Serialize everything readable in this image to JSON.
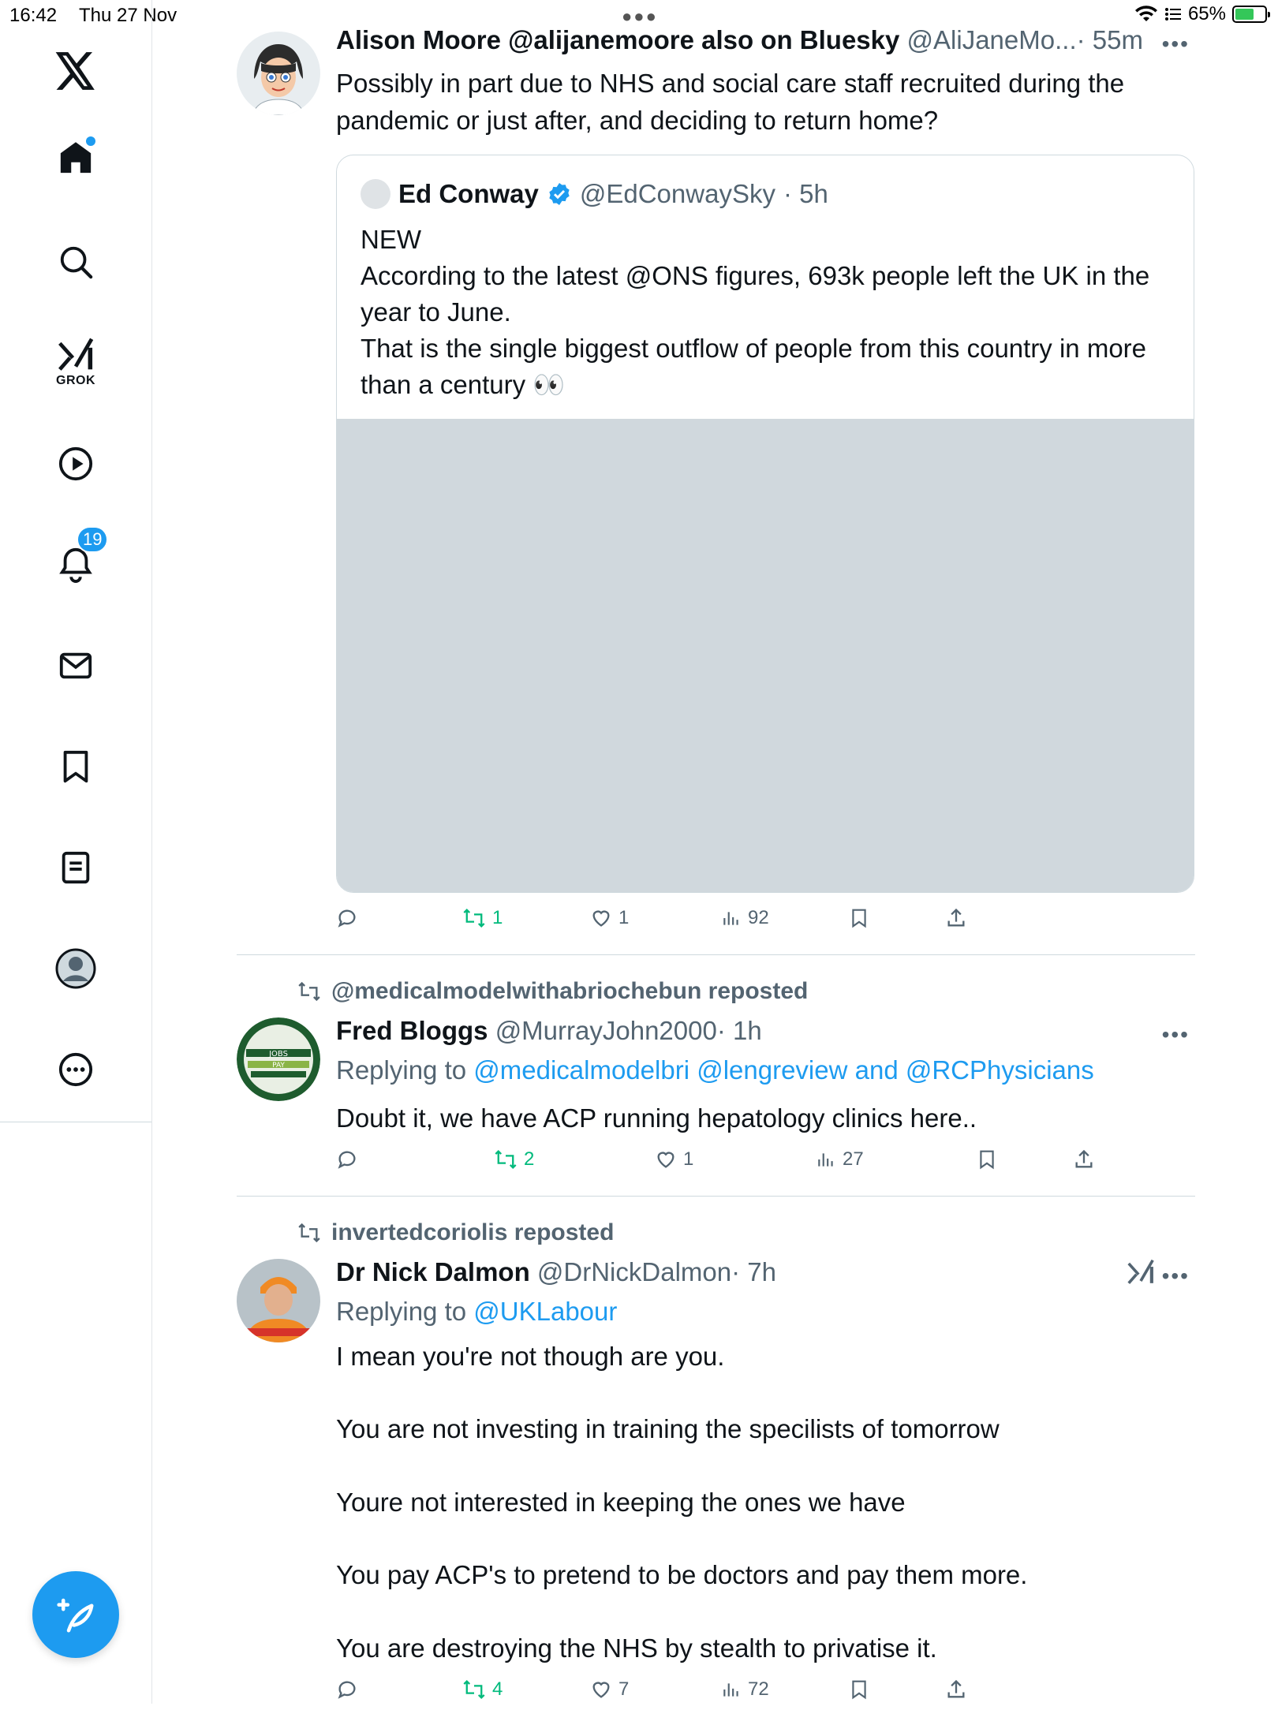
{
  "status_bar": {
    "time": "16:42",
    "date": "Thu 27 Nov",
    "battery": "65%",
    "battery_level": 0.65
  },
  "sidebar": {
    "grok_label": "GROK",
    "notifications_count": "19",
    "items": [
      "x-logo",
      "home-icon",
      "search-icon",
      "grok-icon",
      "play-icon",
      "bell-icon",
      "mail-icon",
      "bookmark-icon",
      "lists-icon",
      "profile-icon",
      "more-icon"
    ]
  },
  "posts": [
    {
      "name": "Alison Moore @alijanemoore also on Bluesky",
      "handle": "@AliJaneMo...",
      "time": "· 55m",
      "text": "Possibly in part due to NHS and social care staff recruited during the pandemic or just after, and deciding to return home?",
      "quote": {
        "name": "Ed Conway",
        "handle": "@EdConwaySky",
        "time": "· 5h",
        "text": "NEW\nAccording to the latest @ONS figures, 693k people left the UK in the year to June.\nThat is the single biggest outflow of people from this country in more than a century 👀"
      },
      "actions": {
        "replies": "",
        "reposts": "1",
        "likes": "1",
        "views": "92"
      }
    },
    {
      "reposted_by": "@medicalmodelwithabriochebun reposted",
      "name": "Fred Bloggs",
      "handle": "@MurrayJohn2000",
      "time": "· 1h",
      "replying_prefix": "Replying to ",
      "replying_to": "@medicalmodelbri @lengreview and @RCPhysicians",
      "text": "Doubt it, we have ACP running hepatology clinics here..",
      "actions": {
        "replies": "",
        "reposts": "2",
        "likes": "1",
        "views": "27"
      }
    },
    {
      "reposted_by": "invertedcoriolis reposted",
      "name": "Dr Nick Dalmon",
      "handle": "@DrNickDalmon",
      "time": "· 7h",
      "replying_prefix": "Replying to ",
      "replying_to": "@UKLabour",
      "text": "I mean you're not though are you.\n\nYou are not investing in training the specilists of tomorrow\n\nYoure not interested in keeping the ones we have\n\nYou pay ACP's to pretend to be doctors and pay them more.\n\nYou are destroying the NHS by stealth to privatise it.",
      "actions": {
        "replies": "",
        "reposts": "4",
        "likes": "7",
        "views": "72"
      }
    }
  ],
  "colors": {
    "accent": "#1d9bf0",
    "repost_green": "#00ba7c",
    "muted": "#536471",
    "border": "#cfd9de"
  }
}
